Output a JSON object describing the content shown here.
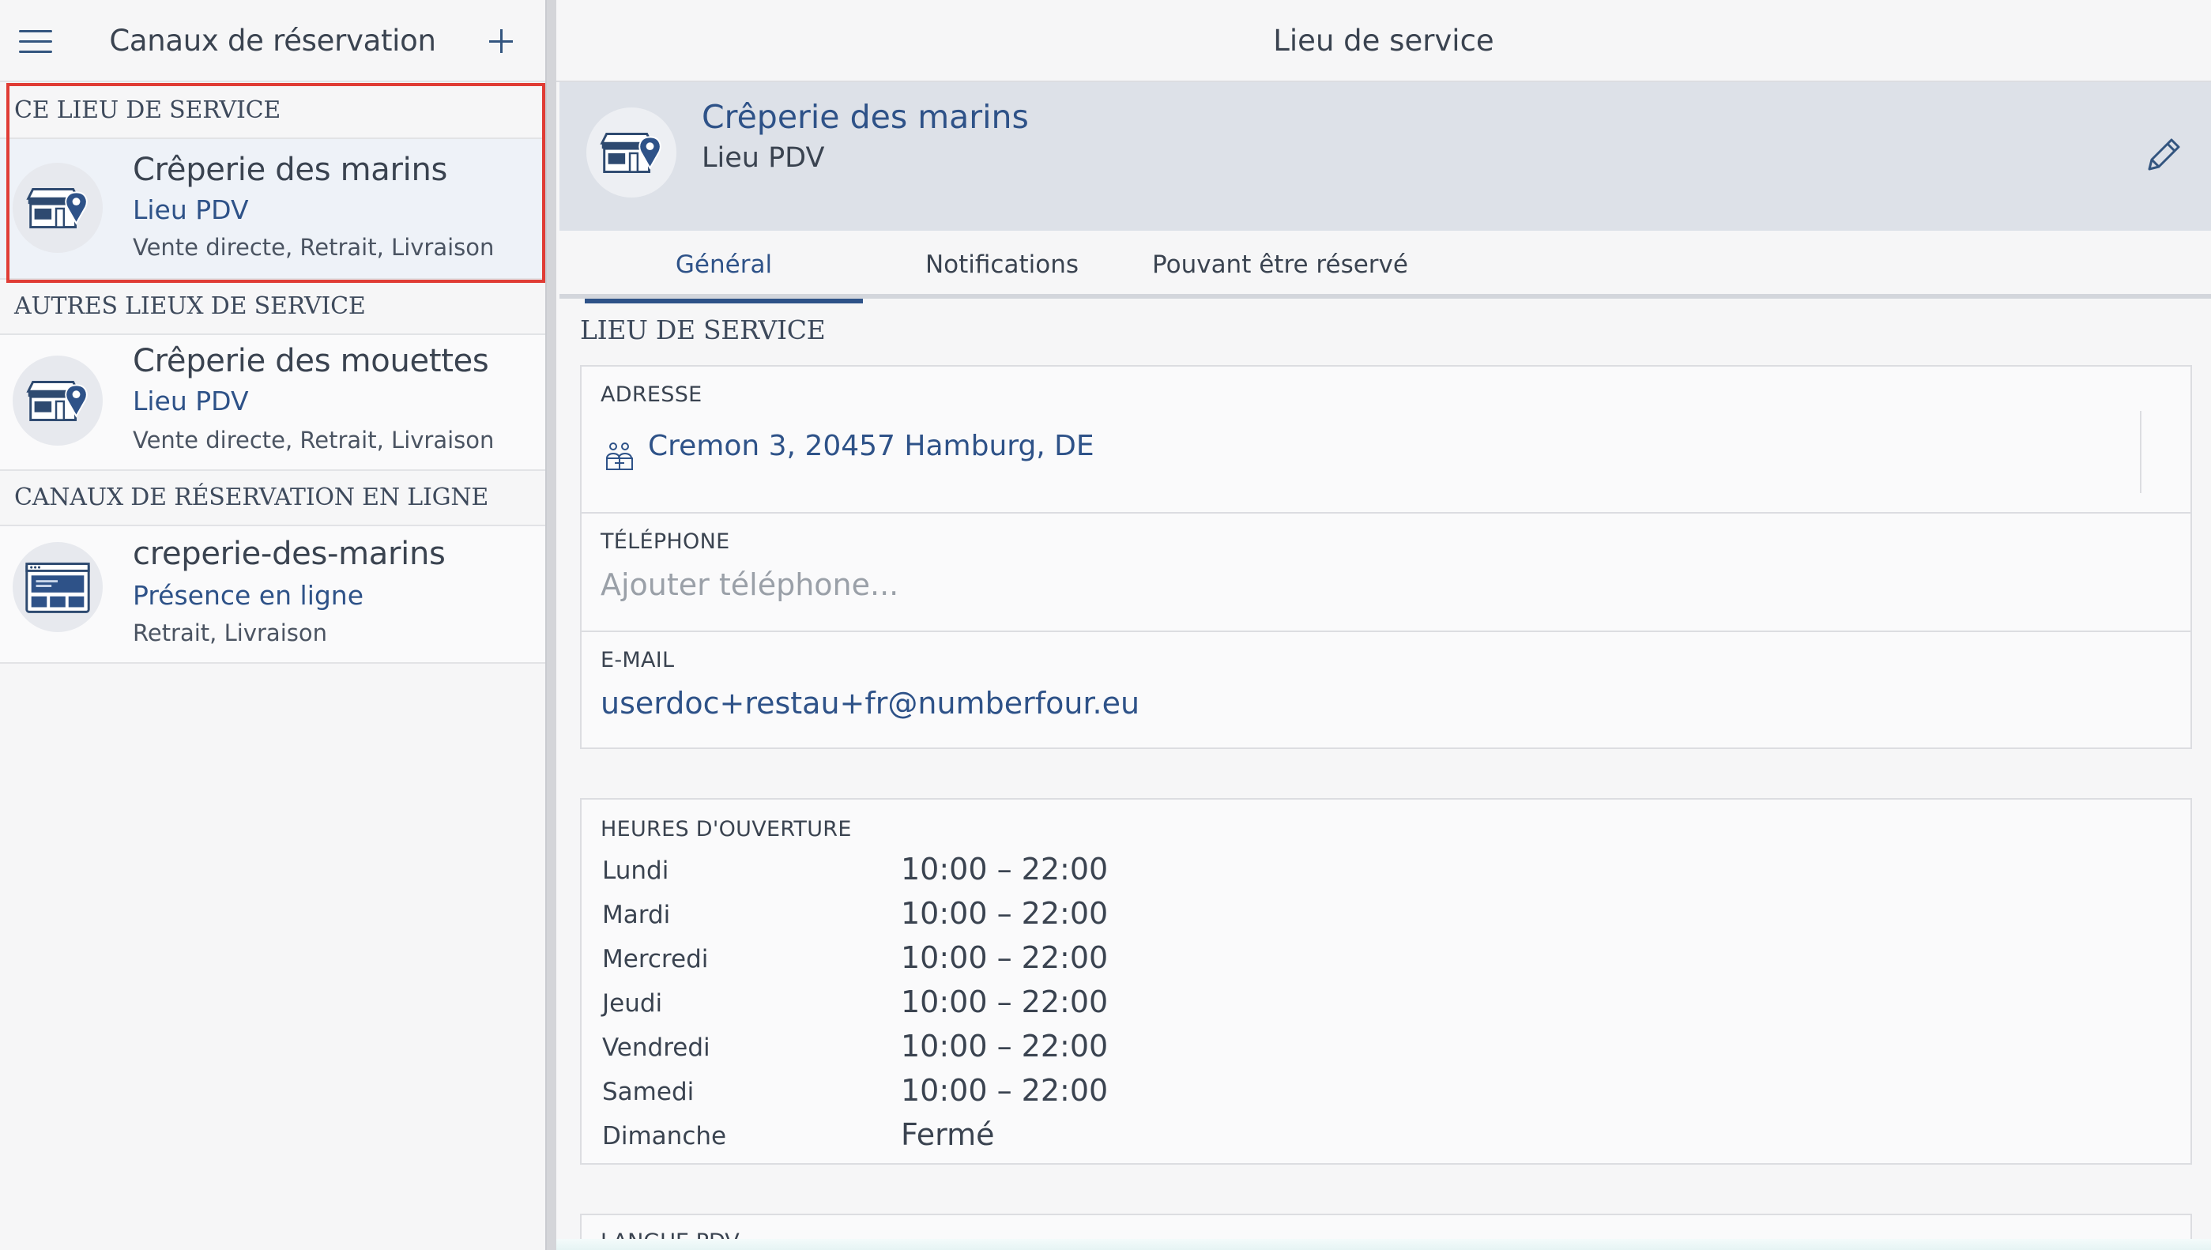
{
  "left_panel": {
    "title": "Canaux de réservation",
    "sections": [
      {
        "header": "CE LIEU DE SERVICE",
        "items": [
          {
            "title": "Crêperie des marins",
            "type": "Lieu PDV",
            "channels": "Vente directe, Retrait, Livraison",
            "icon": "store-location-icon",
            "selected": true
          }
        ]
      },
      {
        "header": "AUTRES LIEUX DE SERVICE",
        "items": [
          {
            "title": "Crêperie des mouettes",
            "type": "Lieu PDV",
            "channels": "Vente directe, Retrait, Livraison",
            "icon": "store-location-icon",
            "selected": false
          }
        ]
      },
      {
        "header": "CANAUX DE RÉSERVATION EN LIGNE",
        "items": [
          {
            "title": "creperie-des-marins",
            "type": "Présence en ligne",
            "channels": "Retrait, Livraison",
            "icon": "web-page-icon",
            "selected": false
          }
        ]
      }
    ]
  },
  "right_panel": {
    "title": "Lieu de service",
    "hero": {
      "title": "Crêperie des marins",
      "subtitle": "Lieu PDV"
    },
    "tabs": [
      {
        "label": "Général",
        "active": true
      },
      {
        "label": "Notifications",
        "active": false
      },
      {
        "label": "Pouvant être réservé",
        "active": false
      }
    ],
    "section_title": "LIEU DE SERVICE",
    "address": {
      "label": "ADRESSE",
      "value": "Cremon 3, 20457 Hamburg, DE"
    },
    "phone": {
      "label": "TÉLÉPHONE",
      "placeholder": "Ajouter téléphone..."
    },
    "email": {
      "label": "E-MAIL",
      "value": "userdoc+restau+fr@numberfour.eu"
    },
    "hours": {
      "label": "HEURES D'OUVERTURE",
      "days": [
        {
          "day": "Lundi",
          "time": "10:00 – 22:00"
        },
        {
          "day": "Mardi",
          "time": "10:00 – 22:00"
        },
        {
          "day": "Mercredi",
          "time": "10:00 – 22:00"
        },
        {
          "day": "Jeudi",
          "time": "10:00 – 22:00"
        },
        {
          "day": "Vendredi",
          "time": "10:00 – 22:00"
        },
        {
          "day": "Samedi",
          "time": "10:00 – 22:00"
        },
        {
          "day": "Dimanche",
          "time": "Fermé"
        }
      ]
    },
    "language": {
      "label": "LANGUE PDV"
    }
  },
  "colors": {
    "accent": "#2e5288",
    "selection_outline": "#e03c35",
    "hero_bg": "#dde1e8"
  }
}
